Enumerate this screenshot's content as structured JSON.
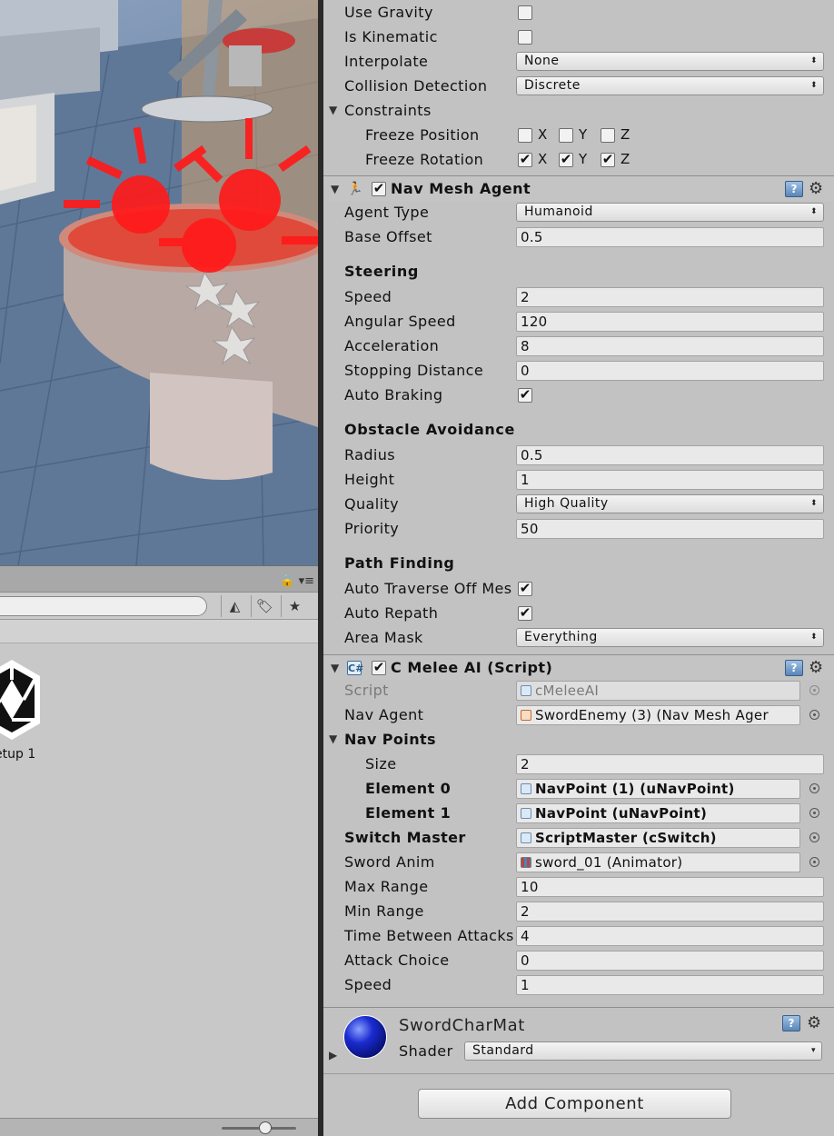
{
  "rigidbody": {
    "use_gravity": {
      "label": "Use Gravity",
      "checked": false
    },
    "is_kinematic": {
      "label": "Is Kinematic",
      "checked": false
    },
    "interpolate": {
      "label": "Interpolate",
      "value": "None"
    },
    "collision_detection": {
      "label": "Collision Detection",
      "value": "Discrete"
    },
    "constraints": {
      "label": "Constraints",
      "freeze_position": {
        "label": "Freeze Position",
        "x": false,
        "y": false,
        "z": false
      },
      "freeze_rotation": {
        "label": "Freeze Rotation",
        "x": true,
        "y": true,
        "z": true
      },
      "axis_x": "X",
      "axis_y": "Y",
      "axis_z": "Z"
    }
  },
  "nav_mesh_agent": {
    "title": "Nav Mesh Agent",
    "enabled": true,
    "agent_type": {
      "label": "Agent Type",
      "value": "Humanoid"
    },
    "base_offset": {
      "label": "Base Offset",
      "value": "0.5"
    },
    "steering": {
      "header": "Steering",
      "speed": {
        "label": "Speed",
        "value": "2"
      },
      "angular_speed": {
        "label": "Angular Speed",
        "value": "120"
      },
      "acceleration": {
        "label": "Acceleration",
        "value": "8"
      },
      "stopping_distance": {
        "label": "Stopping Distance",
        "value": "0"
      },
      "auto_braking": {
        "label": "Auto Braking",
        "checked": true
      }
    },
    "obstacle_avoidance": {
      "header": "Obstacle Avoidance",
      "radius": {
        "label": "Radius",
        "value": "0.5"
      },
      "height": {
        "label": "Height",
        "value": "1"
      },
      "quality": {
        "label": "Quality",
        "value": "High Quality"
      },
      "priority": {
        "label": "Priority",
        "value": "50"
      }
    },
    "path_finding": {
      "header": "Path Finding",
      "auto_traverse": {
        "label": "Auto Traverse Off Mes",
        "checked": true
      },
      "auto_repath": {
        "label": "Auto Repath",
        "checked": true
      },
      "area_mask": {
        "label": "Area Mask",
        "value": "Everything"
      }
    }
  },
  "melee_ai": {
    "title": "C Melee AI (Script)",
    "enabled": true,
    "script": {
      "label": "Script",
      "value": "cMeleeAI"
    },
    "nav_agent": {
      "label": "Nav Agent",
      "value": "SwordEnemy (3) (Nav Mesh Ager"
    },
    "nav_points": {
      "label": "Nav Points",
      "size": {
        "label": "Size",
        "value": "2"
      },
      "element0": {
        "label": "Element 0",
        "value": "NavPoint (1) (uNavPoint)"
      },
      "element1": {
        "label": "Element 1",
        "value": "NavPoint (uNavPoint)"
      }
    },
    "switch_master": {
      "label": "Switch Master",
      "value": "ScriptMaster (cSwitch)"
    },
    "sword_anim": {
      "label": "Sword Anim",
      "value": "sword_01 (Animator)"
    },
    "max_range": {
      "label": "Max Range",
      "value": "10"
    },
    "min_range": {
      "label": "Min Range",
      "value": "2"
    },
    "time_between_attacks": {
      "label": "Time Between Attacks",
      "value": "4"
    },
    "attack_choice": {
      "label": "Attack Choice",
      "value": "0"
    },
    "speed": {
      "label": "Speed",
      "value": "1"
    }
  },
  "material": {
    "name": "SwordCharMat",
    "shader_label": "Shader",
    "shader_value": "Standard"
  },
  "add_component_label": "Add Component",
  "project": {
    "asset_label": "etup 1"
  },
  "icons": {
    "help": "help-book-icon",
    "gear": "gear-icon",
    "checkmark": "✔",
    "dropdown_arrow": "⬍",
    "fold_open": "▼",
    "fold_closed": "▶"
  },
  "colors": {
    "inspector_bg": "#c2c2c2",
    "field_bg": "#e9e9e9",
    "splitter": "#2a2a2a",
    "material_sphere": "#1b2bd0"
  }
}
